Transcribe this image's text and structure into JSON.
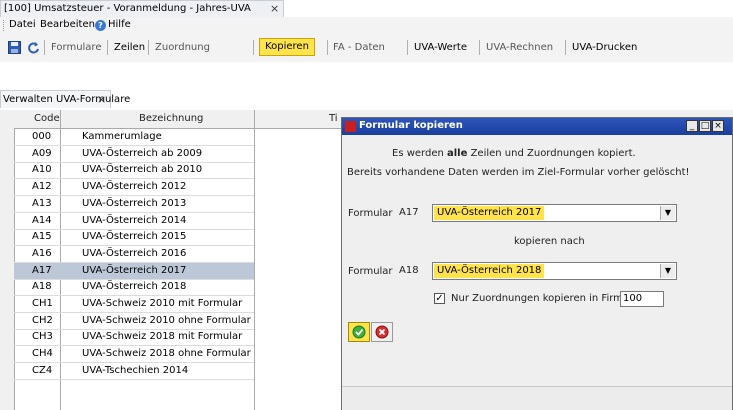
{
  "window_tab": {
    "title": "[100] Umsatzsteuer  -  Voranmeldung  -  Jahres-UVA",
    "close": "×"
  },
  "menu": {
    "datei": "Datei",
    "bearbeiten": "Bearbeiten",
    "hilfe": "Hilfe"
  },
  "toolbar": {
    "formulare": "Formulare",
    "zeilen": "Zeilen",
    "zuordnung": "Zuordnung",
    "kopieren": "Kopieren",
    "fa_daten": "FA - Daten",
    "uva_werte": "UVA-Werte",
    "uva_rechnen": "UVA-Rechnen",
    "uva_drucken": "UVA-Drucken"
  },
  "doc_tab": {
    "title": "Verwalten UVA-Formulare",
    "close": "×"
  },
  "grid": {
    "headers": {
      "code": "Code",
      "bezeichnung": "Bezeichnung",
      "ti": "Ti"
    },
    "rows": [
      {
        "code": "000",
        "name": "Kammerumlage"
      },
      {
        "code": "A09",
        "name": "UVA-Österreich ab 2009"
      },
      {
        "code": "A10",
        "name": "UVA-Österreich ab 2010"
      },
      {
        "code": "A12",
        "name": "UVA-Österreich 2012"
      },
      {
        "code": "A13",
        "name": "UVA-Österreich 2013"
      },
      {
        "code": "A14",
        "name": "UVA-Österreich 2014"
      },
      {
        "code": "A15",
        "name": "UVA-Österreich 2015"
      },
      {
        "code": "A16",
        "name": "UVA-Österreich 2016"
      },
      {
        "code": "A17",
        "name": "UVA-Österreich 2017"
      },
      {
        "code": "A18",
        "name": "UVA-Österreich 2018"
      },
      {
        "code": "CH1",
        "name": "UVA-Schweiz 2010 mit Formular"
      },
      {
        "code": "CH2",
        "name": "UVA-Schweiz 2010 ohne Formular"
      },
      {
        "code": "CH3",
        "name": "UVA-Schweiz 2018 mit Formular"
      },
      {
        "code": "CH4",
        "name": "UVA-Schweiz 2018 ohne Formular"
      },
      {
        "code": "CZ4",
        "name": "UVA-Tschechien 2014"
      }
    ],
    "selected_code": "A17"
  },
  "dialog": {
    "title": "Formular kopieren",
    "info_prefix": "Es werden ",
    "info_bold": "alle",
    "info_suffix": " Zeilen und Zuordnungen kopiert.",
    "info2": "Bereits vorhandene Daten werden im Ziel-Formular vorher gelöscht!",
    "from_label": "Formular",
    "from_code": "A17",
    "from_value": "UVA-Österreich 2017",
    "copy_to": "kopieren nach",
    "to_label": "Formular",
    "to_code": "A18",
    "to_value": "UVA-Österreich 2018",
    "checkbox_label": "Nur Zuordnungen kopieren in Firma",
    "checkbox_checked": true,
    "firma_value": "100"
  }
}
